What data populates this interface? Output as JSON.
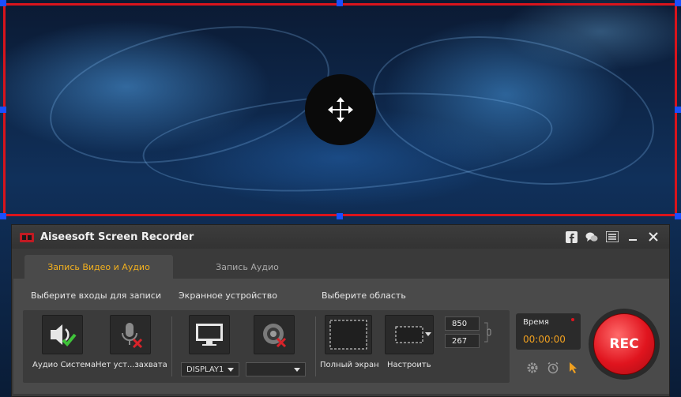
{
  "app": {
    "title": "Aiseesoft Screen Recorder"
  },
  "title_icons": [
    "facebook-icon",
    "chat-icon",
    "menu-icon",
    "minimize-icon",
    "close-icon"
  ],
  "tabs": [
    {
      "label": "Запись Видео и Аудио",
      "active": true
    },
    {
      "label": "Запись Аудио",
      "active": false
    }
  ],
  "sections": {
    "inputs": "Выберите входы для записи",
    "screen_device": "Экранное устройство",
    "area": "Выберите область"
  },
  "inputs": {
    "system_audio_label": "Аудио Система",
    "microphone_label": "Нет уст...захвата"
  },
  "screen": {
    "display_select": "DISPLAY1",
    "webcam_select": ""
  },
  "area": {
    "fullscreen_label": "Полный экран",
    "custom_label": "Настроить",
    "width": "850",
    "height": "267"
  },
  "timer": {
    "label": "Время",
    "value": "00:00:00"
  },
  "rec": {
    "label": "REC"
  },
  "colors": {
    "accent_tab": "#f2b01e",
    "rec_red": "#e0141e",
    "region_border": "#d9141c",
    "handle_blue": "#1a4fff",
    "timer_orange": "#f0a020"
  }
}
